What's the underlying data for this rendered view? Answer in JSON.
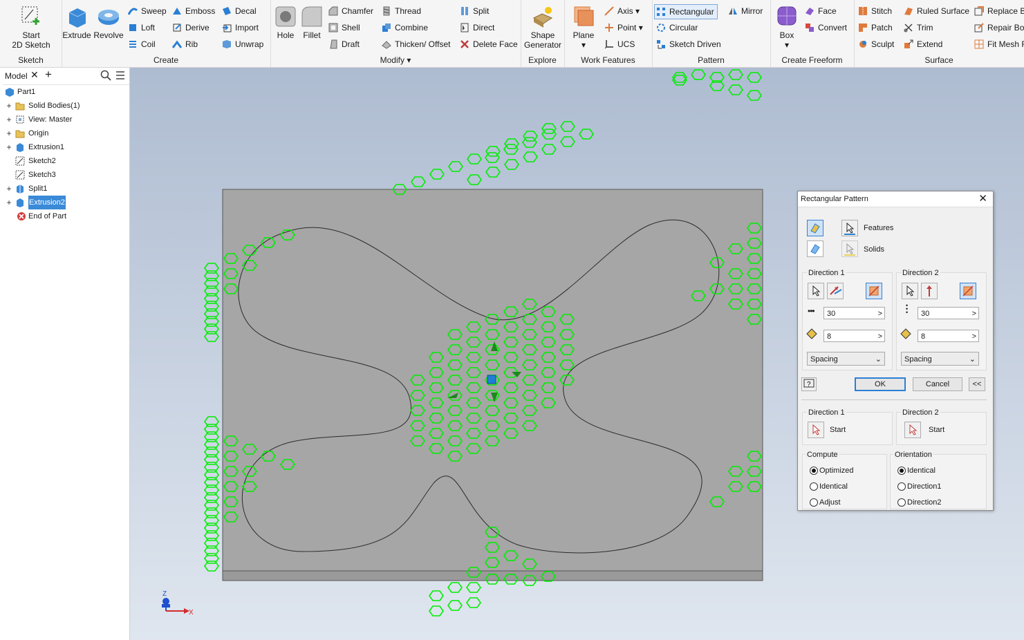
{
  "ribbon": {
    "sketch": {
      "group_label": "Sketch",
      "start_label": "Start",
      "start_label2": "2D Sketch"
    },
    "create": {
      "group_label": "Create",
      "extrude": "Extrude",
      "revolve": "Revolve",
      "sweep": "Sweep",
      "loft": "Loft",
      "coil": "Coil",
      "emboss": "Emboss",
      "derive": "Derive",
      "rib": "Rib",
      "decal": "Decal",
      "import": "Import",
      "unwrap": "Unwrap"
    },
    "modify": {
      "group_label": "Modify",
      "hole": "Hole",
      "fillet": "Fillet",
      "chamfer": "Chamfer",
      "shell": "Shell",
      "draft": "Draft",
      "thread": "Thread",
      "combine": "Combine",
      "thicken": "Thicken/ Offset",
      "split": "Split",
      "direct": "Direct",
      "delete_face": "Delete Face"
    },
    "explore": {
      "group_label": "Explore",
      "shape_gen": "Shape",
      "shape_gen2": "Generator"
    },
    "work_features": {
      "group_label": "Work Features",
      "plane": "Plane",
      "axis": "Axis",
      "point": "Point",
      "ucs": "UCS"
    },
    "pattern": {
      "group_label": "Pattern",
      "rectangular": "Rectangular",
      "circular": "Circular",
      "sketch_driven": "Sketch Driven",
      "mirror": "Mirror"
    },
    "freeform": {
      "group_label": "Create Freeform",
      "box": "Box",
      "face": "Face",
      "convert": "Convert"
    },
    "surface": {
      "group_label": "Surface",
      "stitch": "Stitch",
      "patch": "Patch",
      "sculpt": "Sculpt",
      "ruled": "Ruled Surface",
      "trim": "Trim",
      "extend": "Extend",
      "replace": "Replace Bo",
      "repair": "Repair Bo",
      "fitmesh": "Fit Mesh F"
    }
  },
  "browser": {
    "tab": "Model",
    "items": [
      {
        "label": "Part1"
      },
      {
        "label": "Solid Bodies(1)"
      },
      {
        "label": "View: Master"
      },
      {
        "label": "Origin"
      },
      {
        "label": "Extrusion1"
      },
      {
        "label": "Sketch2"
      },
      {
        "label": "Sketch3"
      },
      {
        "label": "Split1"
      },
      {
        "label": "Extrusion2"
      },
      {
        "label": "End of Part"
      }
    ]
  },
  "viewport": {
    "axis_z": "Z",
    "axis_x": "X",
    "colors": {
      "pattern": "#00ee00",
      "plate": "#a6a6a6",
      "selection": "#1e7fd6"
    }
  },
  "dialog": {
    "title": "Rectangular Pattern",
    "features_label": "Features",
    "solids_label": "Solids",
    "dir1": {
      "title": "Direction 1",
      "count": "30",
      "spacing": "8",
      "mode": "Spacing"
    },
    "dir2": {
      "title": "Direction 2",
      "count": "30",
      "spacing": "8",
      "mode": "Spacing"
    },
    "ok": "OK",
    "cancel": "Cancel",
    "more": "<<",
    "start1_title": "Direction 1",
    "start2_title": "Direction 2",
    "start_label": "Start",
    "compute": {
      "title": "Compute",
      "options": [
        "Optimized",
        "Identical",
        "Adjust"
      ]
    },
    "orientation": {
      "title": "Orientation",
      "options": [
        "Identical",
        "Direction1",
        "Direction2"
      ]
    }
  }
}
